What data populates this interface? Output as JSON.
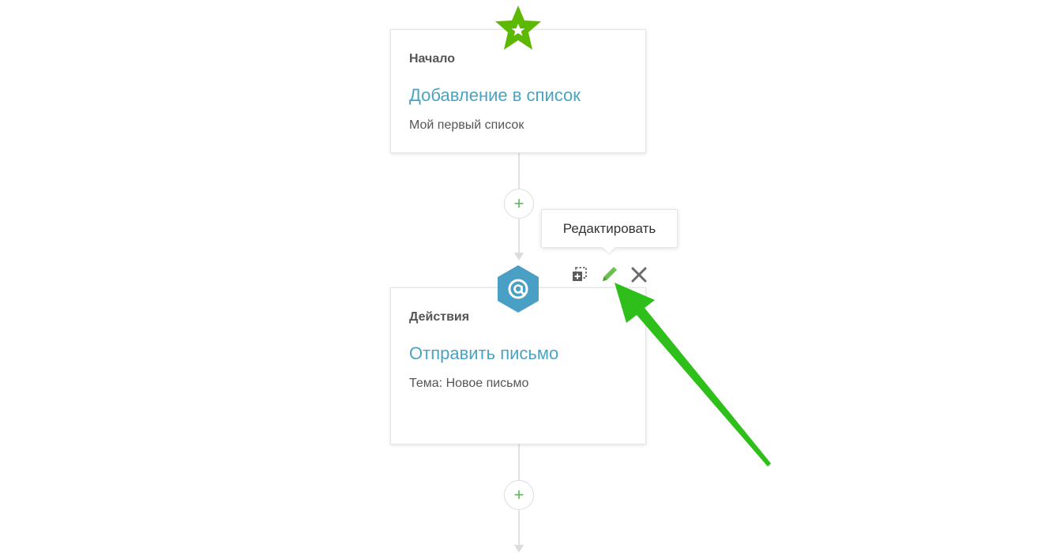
{
  "flow": {
    "start_node": {
      "label": "Начало",
      "title": "Добавление в список",
      "subtitle": "Мой первый список",
      "icon": "star-icon"
    },
    "action_node": {
      "label": "Действия",
      "title": "Отправить письмо",
      "subtitle": "Тема: Новое письмо",
      "icon": "at-sign-icon"
    },
    "add_step_label": "+",
    "tooltip": "Редактировать"
  },
  "colors": {
    "star": "#5cb800",
    "hexagon": "#4a9fc4",
    "title": "#4aa3c3",
    "add": "#5cb85c",
    "pencil": "#6bbf4e",
    "arrow": "#2fbf1a"
  }
}
